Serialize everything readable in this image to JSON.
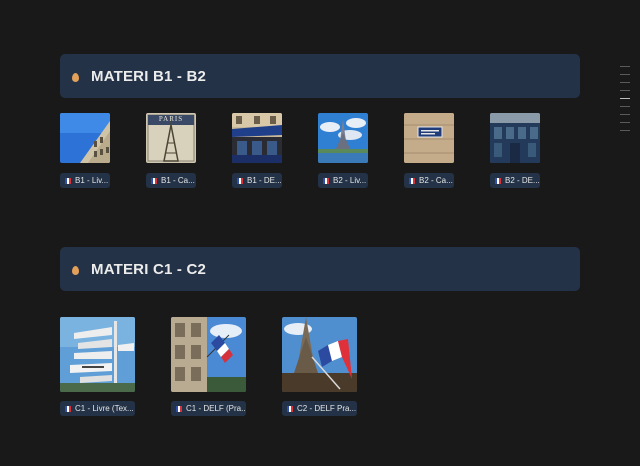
{
  "sections": [
    {
      "title": "MATERI B1 - B2",
      "icon": "drop-icon",
      "items": [
        {
          "label": "B1 - Liv...",
          "flag": "france-flag-icon"
        },
        {
          "label": "B1 - Ca...",
          "flag": "france-flag-icon"
        },
        {
          "label": "B1 - DE...",
          "flag": "france-flag-icon"
        },
        {
          "label": "B2 - Liv...",
          "flag": "france-flag-icon"
        },
        {
          "label": "B2 - Ca...",
          "flag": "france-flag-icon"
        },
        {
          "label": "B2 - DE...",
          "flag": "france-flag-icon"
        }
      ]
    },
    {
      "title": "MATERI C1 - C2",
      "icon": "drop-icon",
      "items": [
        {
          "label": "C1 - Livre (Tex...",
          "flag": "france-flag-icon"
        },
        {
          "label": "C1 - DELF (Pra...",
          "flag": "france-flag-icon"
        },
        {
          "label": "C2 - DELF Pra...",
          "flag": "france-flag-icon"
        }
      ]
    }
  ],
  "thumbnail_text": {
    "paris_poster": "PARIS"
  },
  "colors": {
    "background": "#191919",
    "header_bg": "#233246",
    "chip_bg": "#233246",
    "accent_drop": "#e3a05a",
    "flag_blue": "#2f4fa8",
    "flag_white": "#ffffff",
    "flag_red": "#d6323c"
  }
}
